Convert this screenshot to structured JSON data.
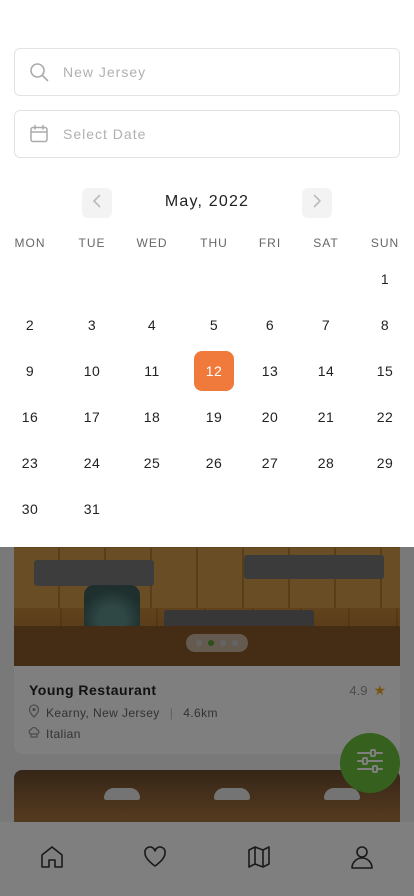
{
  "search": {
    "placeholder": "New Jersey"
  },
  "date_field": {
    "placeholder": "Select Date"
  },
  "calendar": {
    "month_label": "May, 2022",
    "weekdays": [
      "MON",
      "TUE",
      "WED",
      "THU",
      "FRI",
      "SAT",
      "SUN"
    ],
    "selected_day": 12,
    "days": [
      1,
      2,
      3,
      4,
      5,
      6,
      7,
      8,
      9,
      10,
      11,
      12,
      13,
      14,
      15,
      16,
      17,
      18,
      19,
      20,
      21,
      22,
      23,
      24,
      25,
      26,
      27,
      28,
      29,
      30,
      31
    ],
    "selected_color": "#f07a3b"
  },
  "restaurant_card": {
    "name": "Young Restaurant",
    "rating": "4.9",
    "location": "Kearny, New Jersey",
    "distance": "4.6km",
    "cuisine": "Italian"
  },
  "carousel": {
    "count": 4,
    "active_index": 1
  },
  "colors": {
    "accent_green": "#6cc03c",
    "star": "#f2a91c"
  },
  "bottom_nav": {
    "items": [
      "home-icon",
      "heart-icon",
      "map-icon",
      "user-icon"
    ]
  }
}
